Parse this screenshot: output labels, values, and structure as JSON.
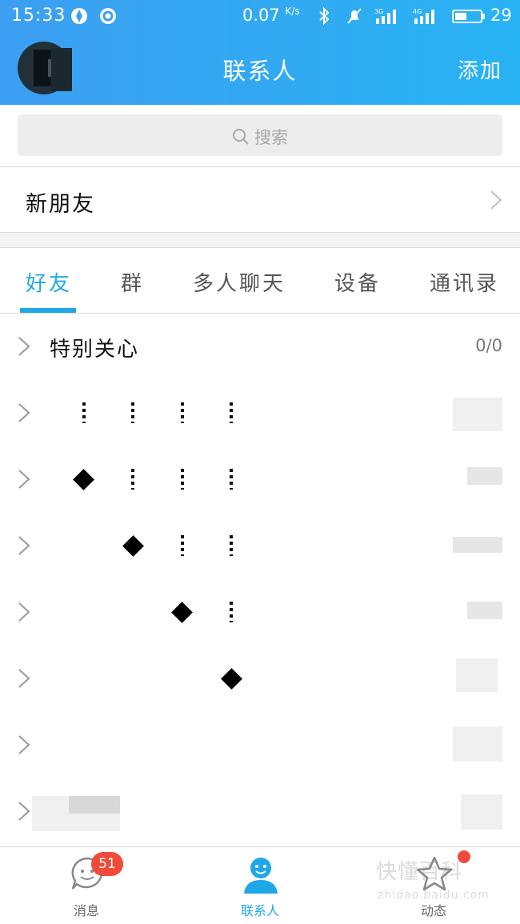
{
  "status_bar": {
    "time": "15:33",
    "speed": "0.07",
    "speed_unit": "K/s",
    "battery_level": "29"
  },
  "header": {
    "title": "联系人",
    "add_label": "添加"
  },
  "search": {
    "placeholder": "搜索"
  },
  "new_friend": {
    "label": "新朋友"
  },
  "tabs": [
    {
      "label": "好友",
      "active": true
    },
    {
      "label": "群",
      "active": false
    },
    {
      "label": "多人聊天",
      "active": false
    },
    {
      "label": "设备",
      "active": false
    },
    {
      "label": "通讯录",
      "active": false
    }
  ],
  "groups": [
    {
      "label": "特别关心",
      "count": "0/0"
    }
  ],
  "bottom_nav": [
    {
      "label": "消息",
      "badge": "51",
      "icon": "message-icon"
    },
    {
      "label": "联系人",
      "icon": "contacts-icon",
      "active": true
    },
    {
      "label": "动态",
      "icon": "star-icon",
      "dot": true
    }
  ],
  "colors": {
    "accent": "#1fa8e8",
    "header_start": "#3d9ff2",
    "header_end": "#27b3f3",
    "badge": "#f04b3a"
  },
  "watermark": {
    "text": "快懂百科",
    "sub": "zhidao.baidu.com"
  }
}
